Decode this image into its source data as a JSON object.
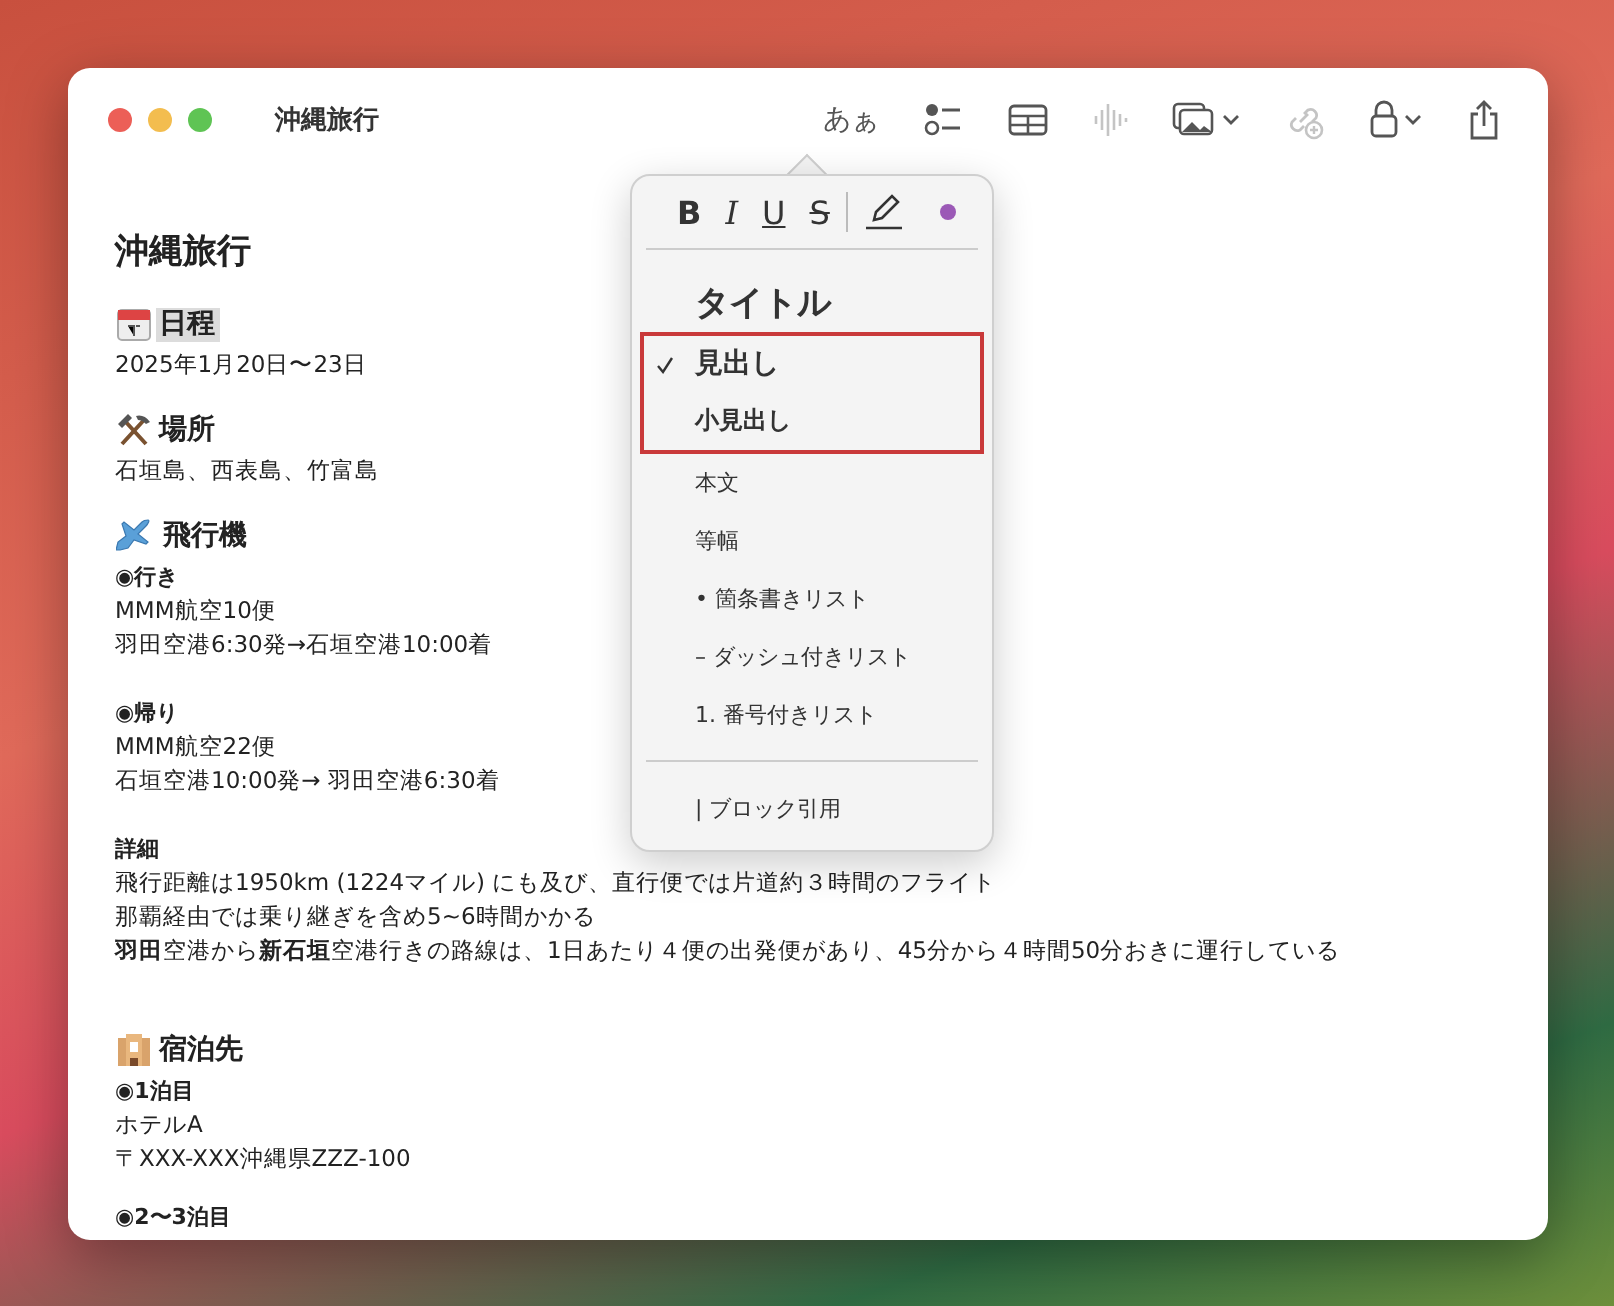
{
  "window": {
    "title": "沖縄旅行"
  },
  "toolbar": {
    "format_button": "あぁ",
    "items": [
      {
        "kind": "checklist",
        "disabled": false
      },
      {
        "kind": "table",
        "disabled": false
      },
      {
        "kind": "audio",
        "disabled": true
      },
      {
        "kind": "media",
        "disabled": false
      },
      {
        "kind": "collab",
        "disabled": true
      },
      {
        "kind": "lock",
        "disabled": false
      },
      {
        "kind": "share",
        "disabled": false
      }
    ]
  },
  "document": [
    {
      "kind": "title",
      "text": "沖縄旅行"
    },
    {
      "kind": "heading",
      "text": "日程",
      "selected": true
    },
    {
      "kind": "body",
      "text": "2025年1月20日〜23日"
    },
    {
      "kind": "gap"
    },
    {
      "kind": "heading",
      "text": "場所",
      "selected": false
    },
    {
      "kind": "body",
      "text": "石垣島、西表島、竹富島"
    },
    {
      "kind": "gap"
    },
    {
      "kind": "heading",
      "text": "飛行機",
      "selected": false
    },
    {
      "kind": "sub",
      "text": "◉行き"
    },
    {
      "kind": "body",
      "text": "MMM航空10便"
    },
    {
      "kind": "body",
      "text": "羽田空港6:30発→石垣空港10:00着"
    },
    {
      "kind": "blank"
    },
    {
      "kind": "sub",
      "text": "◉帰り"
    },
    {
      "kind": "body",
      "text": "MMM航空22便"
    },
    {
      "kind": "body",
      "text": "石垣空港10:00発→ 羽田空港6:30着"
    },
    {
      "kind": "blank"
    },
    {
      "kind": "sub",
      "text": "詳細"
    },
    {
      "kind": "body",
      "text": "飛行距離は1950km (1224マイル) にも及び、直行便では片道約３時間のフライト"
    },
    {
      "kind": "body",
      "text": "那覇経由では乗り継ぎを含め5~6時間かかる"
    },
    {
      "kind": "body",
      "text": "**羽田**空港から**新石垣**空港行きの路線は、1日あたり４便の出発便があり、45分から４時間50分おきに運行している"
    },
    {
      "kind": "blank"
    },
    {
      "kind": "gap"
    },
    {
      "kind": "heading",
      "text": "宿泊先",
      "selected": false
    },
    {
      "kind": "sub",
      "text": "◉1泊目"
    },
    {
      "kind": "body",
      "text": "ホテルA"
    },
    {
      "kind": "body",
      "text": "〒XXX-XXX沖縄県ZZZ-100"
    },
    {
      "kind": "gap"
    },
    {
      "kind": "sub",
      "text": "◉2〜3泊目"
    }
  ],
  "format_menu": {
    "styles": [
      {
        "kind": "bold",
        "label": "B"
      },
      {
        "kind": "italic",
        "label": "I"
      },
      {
        "kind": "underline",
        "label": "U"
      },
      {
        "kind": "strike",
        "label": "S"
      }
    ],
    "items": [
      {
        "kind": "title",
        "label": "タイトル",
        "checked": false,
        "outlined": false
      },
      {
        "kind": "heading",
        "label": "見出し",
        "checked": true,
        "outlined": true
      },
      {
        "kind": "subheading",
        "label": "小見出し",
        "checked": false,
        "outlined": true
      },
      {
        "kind": "body",
        "label": "本文",
        "checked": false,
        "outlined": false
      },
      {
        "kind": "body",
        "label": "等幅",
        "checked": false,
        "outlined": false
      },
      {
        "kind": "body",
        "label": "• 箇条書きリスト",
        "checked": false,
        "outlined": false
      },
      {
        "kind": "body",
        "label": "– ダッシュ付きリスト",
        "checked": false,
        "outlined": false
      },
      {
        "kind": "body",
        "label": "1. 番号付きリスト",
        "checked": false,
        "outlined": false
      },
      {
        "kind": "divider"
      },
      {
        "kind": "body",
        "label": "| ブロック引用",
        "checked": false,
        "outlined": false
      }
    ]
  }
}
